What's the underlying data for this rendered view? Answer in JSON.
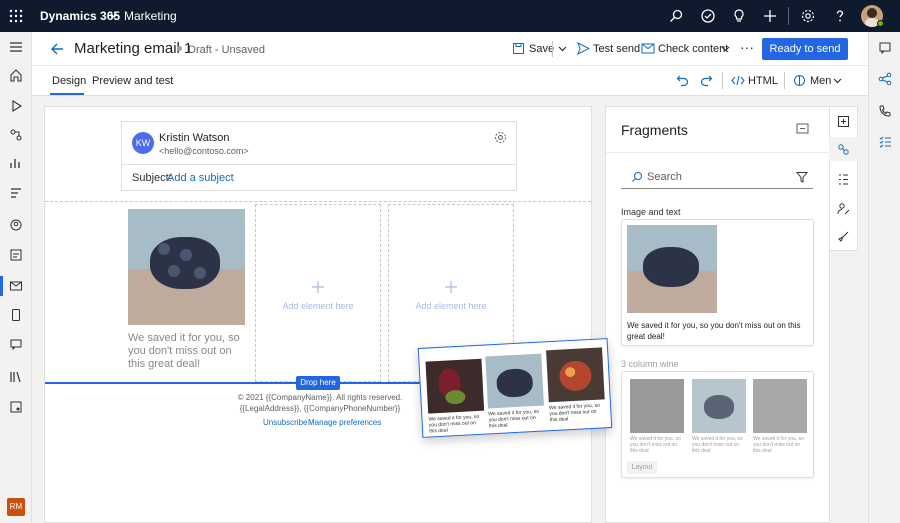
{
  "topbar": {
    "app_name": "Dynamics 365",
    "module": "Marketing"
  },
  "commandbar": {
    "title": "Marketing email 1",
    "status": "Draft - Unsaved",
    "save": "Save",
    "test_send": "Test send",
    "check_content": "Check content",
    "more": "···",
    "ready": "Ready to send"
  },
  "tabs": {
    "design": "Design",
    "preview": "Preview and test",
    "html": "HTML",
    "menu": "Men"
  },
  "email": {
    "sender_initials": "KW",
    "sender_name": "Kristin Watson",
    "sender_email": "<hello@contoso.com>",
    "subject_label": "Subject:",
    "subject_link": "Add a subject",
    "body_text": "We saved it for you, so you don't miss out on this great deal!",
    "add_element": "Add element here",
    "add_element2": "Add element here",
    "drop_here": "Drop here",
    "footer_line1": "© 2021 {{CompanyName}}. All rights reserved.",
    "footer_line2": "{{LegalAddress}}, {{CompanyPhoneNumber}}",
    "unsubscribe": "Unsubscribe",
    "manage_prefs": "Manage preferences"
  },
  "drag_card": {
    "caption1": "We saved it for you, so you don't miss out on this deal",
    "caption2": "We saved it for you, so you don't miss out on this deal",
    "caption3": "We saved it for you, so you don't miss out on this deal"
  },
  "fragments": {
    "title": "Fragments",
    "search_placeholder": "Search",
    "item1_label": "Image and text",
    "item1_text": "We saved it for you, so you don't miss out on this great deal!",
    "item2_label": "3 column wine",
    "item2_caption1": "We saved it for you, so you don't miss out on this deal",
    "item2_caption2": "We saved it for you, so you don't miss out on this deal",
    "item2_caption3": "We saved it for you, so you don't miss out on this deal",
    "item2_type": "Layout"
  },
  "user": {
    "initials": "RM"
  },
  "colors": {
    "topbar": "#0f1a2e",
    "accent": "#2266e3",
    "link": "#0f6cbd",
    "avatar_kw": "#4f6bed",
    "avatar_rm": "#ca5010"
  }
}
